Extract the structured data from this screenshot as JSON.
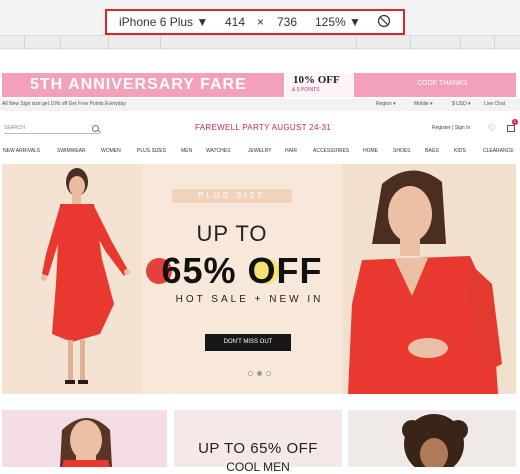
{
  "devtools": {
    "device": "iPhone 6 Plus ▼",
    "width": "414",
    "times": "×",
    "height": "736",
    "zoom": "125% ▼",
    "rotate_icon": "rotate-icon"
  },
  "banner": {
    "title": "5TH ANNIVERSARY FARE",
    "offer_big": "10% OFF",
    "offer_small": "& 5 POINTS",
    "code": "CODE THANKS"
  },
  "promo": {
    "left": "All New Sign size get 10% off    Get Free Points Everyday",
    "region": "Region ▾",
    "mobile": "Mobile ▾",
    "currency": "$ USD ▾",
    "chat": "Live Chat"
  },
  "header": {
    "search_placeholder": "SEARCH",
    "party": "FAREWELL PARTY AUGUST 24-31",
    "register": "Register | Sign In",
    "bag_count": "0"
  },
  "nav": [
    "NEW ARRIVALS",
    "SWIMWEAR",
    "WOMEN",
    "PLUS SIZES",
    "MEN",
    "WATCHES",
    "JEWELRY",
    "HAIR",
    "ACCESSORIES",
    "HOME",
    "SHOES",
    "BAGS",
    "KIDS",
    "CLEARANCE"
  ],
  "hero": {
    "tag": "PLUS SIZE",
    "up_to": "UP TO",
    "discount": "65% OFF",
    "subline": "HOT SALE + NEW IN",
    "cta": "DON'T MISS OUT",
    "slides": 3,
    "active_slide": 2
  },
  "tiles": {
    "b_title": "UP TO 65% OFF",
    "b_sub": "COOL MEN"
  },
  "colors": {
    "banner": "#f3a0bb",
    "accent": "#c7295a",
    "cta": "#171717",
    "dress": "#e8382f"
  }
}
